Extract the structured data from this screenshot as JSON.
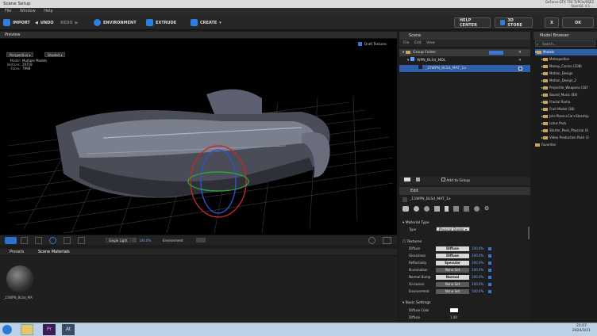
{
  "window": {
    "title": "Scene Setup",
    "gpu": "GeForce GTX 750 Ti/PCIe/SSE2",
    "driver": "OpenGL 4.5 ...",
    "badge": "..."
  },
  "menu": [
    "File",
    "Window",
    "Help"
  ],
  "toolbar": {
    "import": "IMPORT",
    "undo": "UNDO",
    "redo": "REDO",
    "environment": "ENVIRONMENT",
    "extrude": "EXTRUDE",
    "create": "CREATE",
    "help": "HELP CENTER",
    "store": "3D STORE",
    "x": "X",
    "ok": "OK"
  },
  "preview": {
    "title": "Preview",
    "draft_label": "Draft Textures",
    "view_mode": "Perspective",
    "shading": "Shaded",
    "info": [
      {
        "k": "Model:",
        "v": "Multiple Models"
      },
      {
        "k": "Vertices:",
        "v": "29719"
      },
      {
        "k": "Faces:",
        "v": "7998"
      }
    ],
    "single_light": "Single Light",
    "light_pct": "100.0%",
    "environment_label": "Environment"
  },
  "bottom": {
    "tabs": [
      "Presets",
      "Scene Materials"
    ],
    "material_name": "_15WPN_BLSd_MA"
  },
  "scene": {
    "title": "Scene",
    "menu": [
      "File",
      "Edit",
      "View"
    ],
    "rows": [
      "Group Folder",
      "WPN_BLSd_MDL",
      "_15WPN_BLSd_MAT_1a"
    ],
    "add_group": "Add to Group"
  },
  "edit": {
    "title": "Edit",
    "name": "_15WPN_BLSd_MAT_1a",
    "material_type_title": "Material Type",
    "type_label": "Type",
    "type_value": "Physical Shader",
    "textures_title": "Textures",
    "textures": [
      {
        "label": "Diffuse",
        "btn": "Diffuse",
        "pct": "100.0%",
        "set": true
      },
      {
        "label": "Glossiness",
        "btn": "Diffuse",
        "pct": "100.0%",
        "set": true
      },
      {
        "label": "Reflectivity",
        "btn": "Specular",
        "pct": "100.0%",
        "set": true
      },
      {
        "label": "Illumination",
        "btn": "None Set",
        "pct": "100.0%",
        "set": false
      },
      {
        "label": "Normal Bump",
        "btn": "Normal",
        "pct": "100.0%",
        "set": true
      },
      {
        "label": "Occlusion",
        "btn": "None Set",
        "pct": "100.0%",
        "set": false
      },
      {
        "label": "Environment",
        "btn": "None Set",
        "pct": "100.0%",
        "set": false
      }
    ],
    "basic_title": "Basic Settings",
    "diffuse_color": "Diffuse Color",
    "diffuse": "Diffuse",
    "diffuse_val": "1.00"
  },
  "browser": {
    "title": "Model Browser",
    "search": "Search...",
    "items": [
      "Models",
      "Metropolitan",
      "Money_Casino (108)",
      "Motion_Design",
      "Motion_Design_2",
      "Projectile_Weapons (187",
      "Sound_Music (84)",
      "Fractal Rama",
      "Fruit Model (38)",
      "Jet+Plane+Car+Starship",
      "Lotus Pack",
      "Starter_Pack_Physical (4",
      "Video Production Pack (3",
      "Favorites"
    ]
  },
  "taskbar": {
    "time": "21:07",
    "date": "2024/3/21"
  },
  "colors": {
    "accent": "#3a78d8",
    "selected": "#2f5fa8",
    "toolbar_icon": "#2f7fe0"
  }
}
